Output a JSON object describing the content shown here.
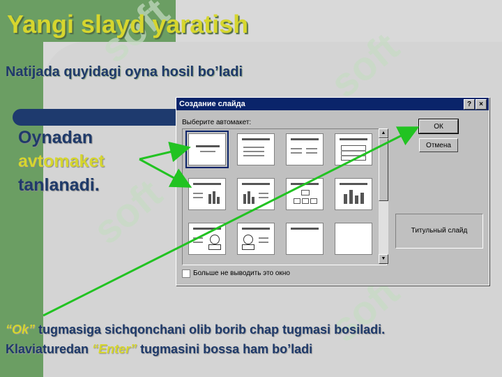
{
  "slide": {
    "title": "Yangi slayd yaratish",
    "subtitle": "Natijada quyidagi oyna hosil bo’ladi",
    "bullet": {
      "line1": "Oynadan",
      "line2": "avtomaket",
      "line3": "tanlanadi."
    },
    "bottom": {
      "line1_hl": "“Ok”",
      "line1_rest": " tugmasiga sichqonchani olib borib chap tugmasi bosiladi.",
      "line2_pre": "Klaviaturedan ",
      "line2_hl": "“Enter”",
      "line2_rest": " tugmasini bossa ham bo’ladi"
    },
    "watermark": "soft",
    "colors": {
      "green": "#6b9e63",
      "navy": "#1f3a6a",
      "yellow": "#d6d62e",
      "arrow": "#22c322"
    }
  },
  "dialog": {
    "title": "Создание слайда",
    "help_btn": "?",
    "close_btn": "×",
    "choose_label": "Выберите автомакет:",
    "ok_label": "ОК",
    "cancel_label": "Отмена",
    "preview_label": "Титульный слайд",
    "checkbox_label": "Больше не выводить это окно",
    "checkbox_checked": false,
    "scroll_up": "▲",
    "scroll_down": "▼"
  }
}
